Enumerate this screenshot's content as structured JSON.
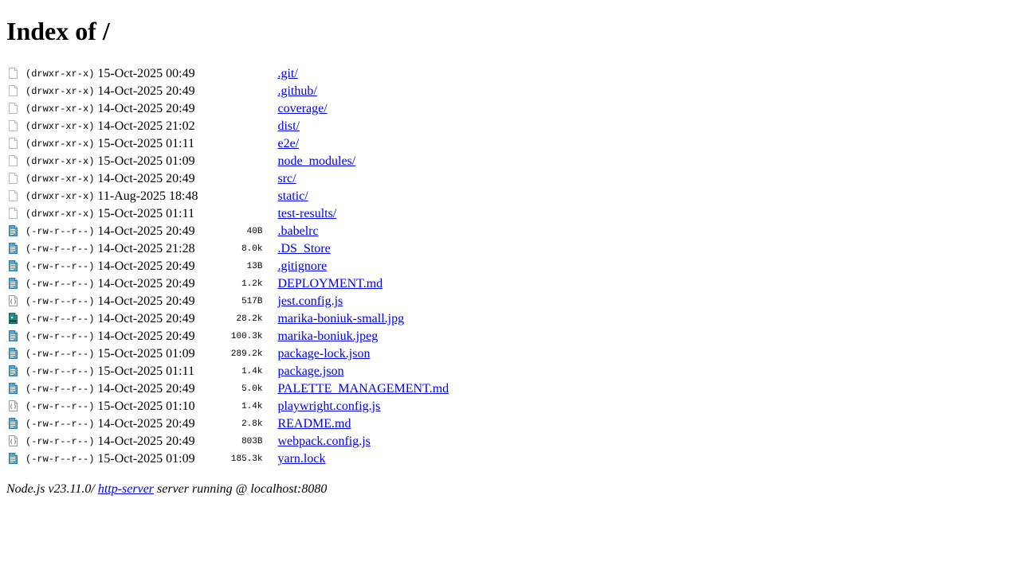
{
  "title": "Index of /",
  "entries": [
    {
      "icon": "blank-file-icon",
      "perms": "(drwxr-xr-x)",
      "date": "15-Oct-2025 00:49",
      "size": "",
      "name": ".git/"
    },
    {
      "icon": "blank-file-icon",
      "perms": "(drwxr-xr-x)",
      "date": "14-Oct-2025 20:49",
      "size": "",
      "name": ".github/"
    },
    {
      "icon": "blank-file-icon",
      "perms": "(drwxr-xr-x)",
      "date": "14-Oct-2025 20:49",
      "size": "",
      "name": "coverage/"
    },
    {
      "icon": "blank-file-icon",
      "perms": "(drwxr-xr-x)",
      "date": "14-Oct-2025 21:02",
      "size": "",
      "name": "dist/"
    },
    {
      "icon": "blank-file-icon",
      "perms": "(drwxr-xr-x)",
      "date": "15-Oct-2025 01:11",
      "size": "",
      "name": "e2e/"
    },
    {
      "icon": "blank-file-icon",
      "perms": "(drwxr-xr-x)",
      "date": "15-Oct-2025 01:09",
      "size": "",
      "name": "node_modules/"
    },
    {
      "icon": "blank-file-icon",
      "perms": "(drwxr-xr-x)",
      "date": "14-Oct-2025 20:49",
      "size": "",
      "name": "src/"
    },
    {
      "icon": "blank-file-icon",
      "perms": "(drwxr-xr-x)",
      "date": "11-Aug-2025 18:48",
      "size": "",
      "name": "static/"
    },
    {
      "icon": "blank-file-icon",
      "perms": "(drwxr-xr-x)",
      "date": "15-Oct-2025 01:11",
      "size": "",
      "name": "test-results/"
    },
    {
      "icon": "text-file-icon",
      "perms": "(-rw-r--r--)",
      "date": "14-Oct-2025 20:49",
      "size": "40B",
      "name": ".babelrc"
    },
    {
      "icon": "text-file-icon",
      "perms": "(-rw-r--r--)",
      "date": "14-Oct-2025 21:28",
      "size": "8.0k",
      "name": ".DS_Store"
    },
    {
      "icon": "text-file-icon",
      "perms": "(-rw-r--r--)",
      "date": "14-Oct-2025 20:49",
      "size": "13B",
      "name": ".gitignore"
    },
    {
      "icon": "text-file-icon",
      "perms": "(-rw-r--r--)",
      "date": "14-Oct-2025 20:49",
      "size": "1.2k",
      "name": "DEPLOYMENT.md"
    },
    {
      "icon": "script-file-icon",
      "perms": "(-rw-r--r--)",
      "date": "14-Oct-2025 20:49",
      "size": "517B",
      "name": "jest.config.js"
    },
    {
      "icon": "image-file-icon",
      "perms": "(-rw-r--r--)",
      "date": "14-Oct-2025 20:49",
      "size": "28.2k",
      "name": "marika-boniuk-small.jpg"
    },
    {
      "icon": "text-file-icon",
      "perms": "(-rw-r--r--)",
      "date": "14-Oct-2025 20:49",
      "size": "100.3k",
      "name": "marika-boniuk.jpeg"
    },
    {
      "icon": "text-file-icon",
      "perms": "(-rw-r--r--)",
      "date": "15-Oct-2025 01:09",
      "size": "289.2k",
      "name": "package-lock.json"
    },
    {
      "icon": "text-file-icon",
      "perms": "(-rw-r--r--)",
      "date": "15-Oct-2025 01:11",
      "size": "1.4k",
      "name": "package.json"
    },
    {
      "icon": "text-file-icon",
      "perms": "(-rw-r--r--)",
      "date": "14-Oct-2025 20:49",
      "size": "5.0k",
      "name": "PALETTE_MANAGEMENT.md"
    },
    {
      "icon": "script-file-icon",
      "perms": "(-rw-r--r--)",
      "date": "15-Oct-2025 01:10",
      "size": "1.4k",
      "name": "playwright.config.js"
    },
    {
      "icon": "text-file-icon",
      "perms": "(-rw-r--r--)",
      "date": "14-Oct-2025 20:49",
      "size": "2.8k",
      "name": "README.md"
    },
    {
      "icon": "script-file-icon",
      "perms": "(-rw-r--r--)",
      "date": "14-Oct-2025 20:49",
      "size": "803B",
      "name": "webpack.config.js"
    },
    {
      "icon": "text-file-icon",
      "perms": "(-rw-r--r--)",
      "date": "15-Oct-2025 01:09",
      "size": "185.3k",
      "name": "yarn.lock"
    }
  ],
  "footer": {
    "prefix": "Node.js v23.11.0/ ",
    "link": "http-server",
    "suffix": " server running @ localhost:8080"
  },
  "colors": {
    "link": "#0000ee",
    "text_icon": "#3a9ad9",
    "image_icon": "#1f8f8a"
  }
}
